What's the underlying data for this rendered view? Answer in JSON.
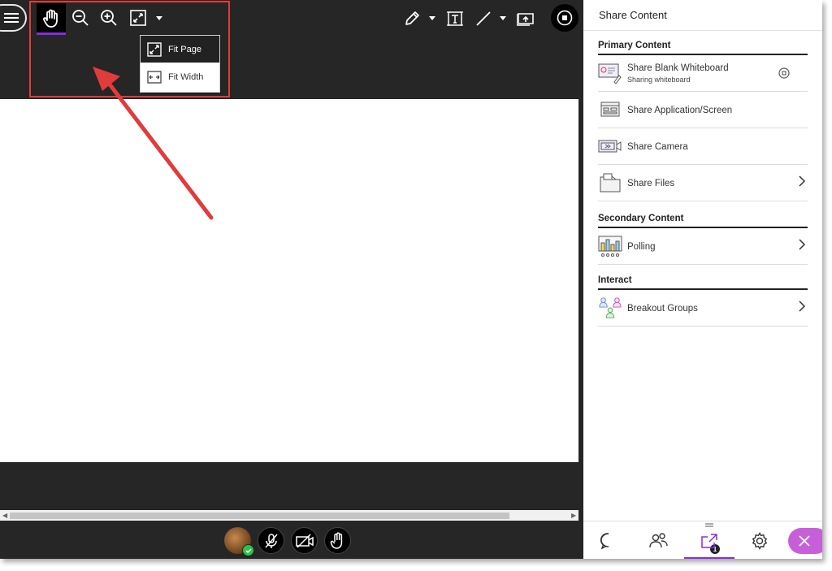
{
  "toolbar": {
    "zoom_dropdown": {
      "items": [
        {
          "label": "Fit Page",
          "icon": "fit-page-icon",
          "selected": true
        },
        {
          "label": "Fit Width",
          "icon": "fit-width-icon",
          "selected": false
        }
      ]
    },
    "tools": [
      "menu-icon",
      "hand-icon",
      "zoom-out-icon",
      "zoom-in-icon",
      "fit-page-icon",
      "caret-down-icon",
      "pencil-icon",
      "text-icon",
      "line-icon",
      "image-stamp-icon",
      "stop-sharing-icon"
    ]
  },
  "panel": {
    "title": "Share Content",
    "sections": [
      {
        "heading": "Primary Content",
        "items": [
          {
            "label": "Share Blank Whiteboard",
            "sublabel": "Sharing whiteboard",
            "icon": "whiteboard-icon",
            "trailing": "stop-circle-icon"
          },
          {
            "label": "Share Application/Screen",
            "icon": "screen-share-icon",
            "trailing": ""
          },
          {
            "label": "Share Camera",
            "icon": "camera-share-icon",
            "trailing": ""
          },
          {
            "label": "Share Files",
            "icon": "folder-icon",
            "trailing": "chevron-right-icon"
          }
        ]
      },
      {
        "heading": "Secondary Content",
        "items": [
          {
            "label": "Polling",
            "icon": "polling-icon",
            "trailing": "chevron-right-icon"
          }
        ]
      },
      {
        "heading": "Interact",
        "items": [
          {
            "label": "Breakout Groups",
            "icon": "breakout-groups-icon",
            "trailing": "chevron-right-icon"
          }
        ]
      }
    ]
  },
  "tabbar": {
    "tabs": [
      "chat-icon",
      "attendees-icon",
      "share-content-icon",
      "settings-icon",
      "close-icon"
    ],
    "attendees_badge": "1",
    "active_tab": "share-content-icon"
  },
  "media_controls": [
    "avatar",
    "microphone-muted-icon",
    "camera-off-icon",
    "raise-hand-icon"
  ],
  "colors": {
    "accent": "#8a2be2",
    "annotation": "#e23b3b",
    "close_fab": "#c760d8",
    "dark_bg": "#262626"
  }
}
